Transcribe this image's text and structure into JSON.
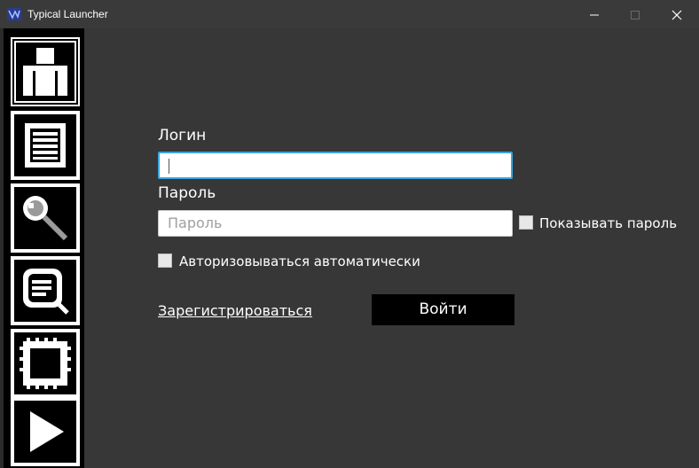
{
  "window": {
    "title": "Typical Launcher",
    "minimize_icon": "minimize-icon",
    "maximize_icon": "maximize-icon",
    "close_icon": "close-icon"
  },
  "sidebar": {
    "items": [
      {
        "icon": "profile-icon",
        "selected": true
      },
      {
        "icon": "news-list-icon",
        "selected": false
      },
      {
        "icon": "search-icon",
        "selected": false
      },
      {
        "icon": "chat-search-icon",
        "selected": false
      },
      {
        "icon": "settings-frame-icon",
        "selected": false
      },
      {
        "icon": "play-icon",
        "selected": false
      }
    ]
  },
  "form": {
    "login_label": "Логин",
    "login_value": "",
    "password_label": "Пароль",
    "password_placeholder": "Пароль",
    "show_password_label": "Показывать пароль",
    "auto_login_label": "Авторизовываться автоматически",
    "register_link": "Зарегистрироваться",
    "submit_label": "Войти"
  },
  "colors": {
    "background": "#373737",
    "sidebar": "#000000",
    "focus_border": "#3aa6e0",
    "text": "#ffffff"
  }
}
